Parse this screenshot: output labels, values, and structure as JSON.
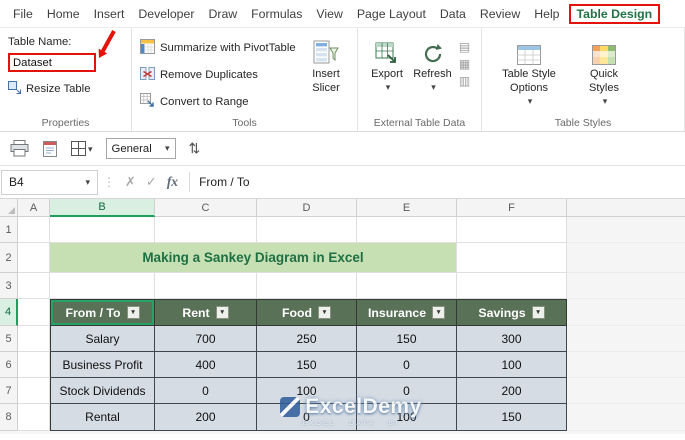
{
  "tabs": [
    "File",
    "Home",
    "Insert",
    "Developer",
    "Draw",
    "Formulas",
    "View",
    "Page Layout",
    "Data",
    "Review",
    "Help",
    "Table Design"
  ],
  "active_tab": "Table Design",
  "ribbon": {
    "properties": {
      "table_name_label": "Table Name:",
      "table_name_value": "Dataset",
      "resize_table": "Resize Table",
      "group_label": "Properties"
    },
    "tools": {
      "summarize": "Summarize with PivotTable",
      "remove_duplicates": "Remove Duplicates",
      "convert_to_range": "Convert to Range",
      "insert_slicer": "Insert Slicer",
      "group_label": "Tools"
    },
    "external": {
      "export": "Export",
      "refresh": "Refresh",
      "group_label": "External Table Data"
    },
    "styles": {
      "table_style_options": "Table Style Options",
      "quick_styles": "Quick Styles",
      "group_label": "Table Styles"
    }
  },
  "qat": {
    "number_format": "General"
  },
  "formula_bar": {
    "name_box": "B4",
    "fx": "fx",
    "content": "From / To"
  },
  "sheet": {
    "col_headers": [
      "A",
      "B",
      "C",
      "D",
      "E",
      "F"
    ],
    "row_headers": [
      "1",
      "2",
      "3",
      "4",
      "5",
      "6",
      "7",
      "8"
    ],
    "title": "Making a Sankey Diagram in Excel",
    "selected_cell": "B4"
  },
  "table": {
    "headers": [
      "From / To",
      "Rent",
      "Food",
      "Insurance",
      "Savings"
    ],
    "rows": [
      [
        "Salary",
        "700",
        "250",
        "150",
        "300"
      ],
      [
        "Business Profit",
        "400",
        "150",
        "0",
        "100"
      ],
      [
        "Stock Dividends",
        "0",
        "100",
        "0",
        "200"
      ],
      [
        "Rental",
        "200",
        "0",
        "100",
        "150"
      ]
    ]
  },
  "watermark": {
    "brand": "ExcelDemy",
    "tagline": "EXCEL · DATA · BI"
  },
  "colors": {
    "excel_green": "#217346",
    "annotation_red": "#E3120B",
    "table_header_bg": "#587157",
    "table_row_bg": "#D6DCE4",
    "title_band_bg": "#C6E0B4",
    "title_text": "#1D7044"
  }
}
